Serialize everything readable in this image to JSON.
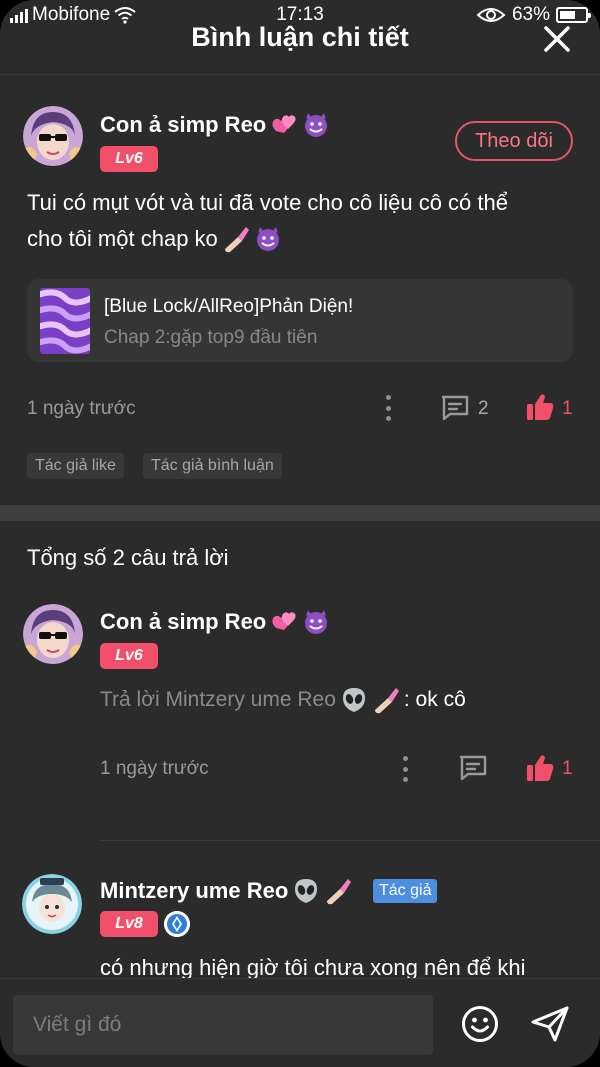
{
  "status_bar": {
    "carrier": "Mobifone",
    "time": "17:13",
    "battery": "63%",
    "battery_level": 0.63
  },
  "header": {
    "title": "Bình luận chi tiết"
  },
  "comment": {
    "username": "Con ả simp Reo",
    "level": "Lv6",
    "follow_label": "Theo dõi",
    "text_line1": "Tui có mụt vót và tui đã vote cho cô liệu cô có thể",
    "text_line2": "cho tôi một chap ko",
    "story": {
      "title": "[Blue Lock/AllReo]Phản Diện!",
      "chapter": "Chap 2:gặp top9 đầu tiên"
    },
    "time": "1 ngày trước",
    "reply_count": "2",
    "like_count": "1",
    "tags": [
      "Tác giả like",
      "Tác giả bình luận"
    ]
  },
  "replies_total": "Tổng số 2 câu trả lời",
  "replies": [
    {
      "username": "Con ả simp Reo",
      "level": "Lv6",
      "reply_prefix": "Trả lời Mintzery ume Reo",
      "reply_text": ": ok cô",
      "time": "1 ngày trước",
      "like_count": "1"
    },
    {
      "username": "Mintzery ume Reo",
      "author_badge": "Tác giả",
      "level": "Lv8",
      "text_partial": "có nhưng hiện giờ tôi chưa xong nên để khi"
    }
  ],
  "composer": {
    "placeholder": "Viết gì đó"
  },
  "colors": {
    "background": "#2b2b2c",
    "accent_pink": "#f2506a",
    "author_blue": "#4c8ee0"
  },
  "icons": [
    "close-icon",
    "kebab-icon",
    "comment-icon",
    "thumbs-up-icon",
    "emoji-icon",
    "send-icon",
    "verified-icon"
  ]
}
